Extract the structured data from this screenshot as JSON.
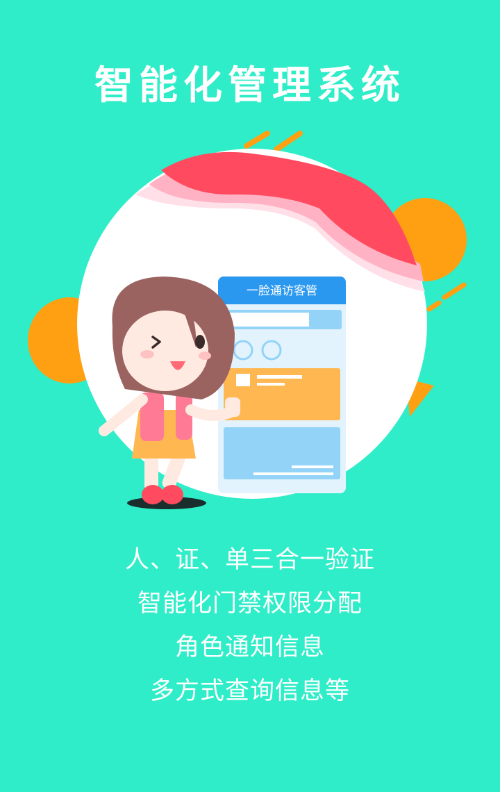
{
  "header": {
    "title": "智能化管理系统"
  },
  "phone_mockup": {
    "app_title": "一脸通访客管"
  },
  "features": [
    "人、证、单三合一验证",
    "智能化门禁权限分配",
    "角色通知信息",
    "多方式查询信息等"
  ],
  "colors": {
    "background": "#2fedc8",
    "circle": "#ffffff",
    "accent_orange": "#ff9f12",
    "accent_red": "#ff4a5f",
    "accent_pink": "#ffb2c4",
    "phone_header": "#2b98f0",
    "phone_card_orange": "#ffb851",
    "phone_card_blue": "#92d3f7"
  }
}
